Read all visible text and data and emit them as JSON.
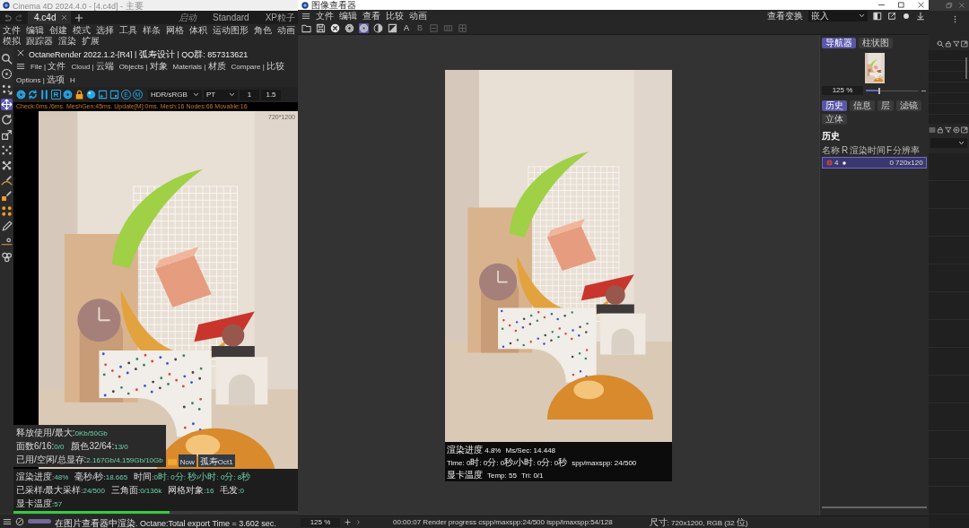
{
  "c4d": {
    "title": "Cinema 4D 2024.4.0 - [4.c4d] - 主要",
    "document_tabs": [
      {
        "label": "4.c4d",
        "selected": true
      }
    ],
    "layouts": [
      "启动",
      "Standard",
      "XP粒子"
    ],
    "menu": [
      "文件",
      "编辑",
      "创建",
      "模式",
      "选择",
      "工具",
      "样条",
      "网格",
      "体积",
      "运动图形",
      "角色",
      "动画",
      "模拟",
      "跟踪器",
      "渲染",
      "扩展"
    ],
    "tools": [
      {
        "selected": false
      },
      {
        "selected": false
      },
      {
        "selected": false
      },
      {
        "selected": true
      },
      {
        "selected": false
      },
      {
        "selected": false
      },
      {
        "selected": false
      },
      {
        "selected": false
      },
      {
        "selected": false
      },
      {
        "selected": false
      },
      {
        "selected": false
      },
      {
        "selected": false
      },
      {
        "selected": false
      },
      {
        "selected": false
      }
    ]
  },
  "octane": {
    "title": "OctaneRender 2022.1.2-[R4]  | 弧寿设计 | QQ群: 857313621",
    "menu": [
      "File | 文件",
      "Cloud | 云端",
      "Objects | 对象",
      "Materials | 材质",
      "Compare | 比较",
      "Options | 选项",
      "H"
    ],
    "toolbar": {
      "letter_buttons": [
        "R",
        "E",
        "M"
      ],
      "dropdowns": [
        "HDR/sRGB",
        "PT"
      ],
      "fields": [
        "1",
        "1.5"
      ]
    },
    "timings": "Check:0ms./6ms. MeshGen:45ms. Update[M]:0ms. Mesh:16 Nodes:66 Movable:16",
    "resolution": "720*1200",
    "memory": [
      [
        {
          "label": "释放使用/最大:",
          "value": "0Kb/50Gb"
        }
      ],
      [
        {
          "label": "面数6/16:",
          "value": "0/0"
        },
        {
          "label": "颜色32/64:",
          "value": "13/0"
        }
      ],
      [
        {
          "label": "已用/空闲/总显存:",
          "value": "2.167Gb/4.159Gb/10Gb"
        }
      ]
    ],
    "hud_tags": [
      "Now",
      "孤寿Oct1"
    ],
    "stats": [
      {
        "label": "渲染进度:",
        "value": "48%"
      },
      {
        "label": "毫秒/秒:",
        "value": "18.665"
      },
      {
        "label": "时间:",
        "value": "0时: 0分: 秒/小时: 0分: 8秒"
      },
      {
        "label": "已采样/最大采样:",
        "value": "24/500"
      },
      {
        "label": "三角面:",
        "value": "0/136k"
      },
      {
        "label": "网格对象:",
        "value": "16"
      },
      {
        "label": "毛发:",
        "value": "0"
      },
      {
        "label": "显卡温度:",
        "value": "57"
      }
    ],
    "progress": {
      "level": 0.55
    }
  },
  "status_bar": {
    "message": "在图片查看器中渲染. Octane:Total export Time = 3.602 sec."
  },
  "viewer": {
    "title": "图像查看器",
    "menu": [
      "文件",
      "编辑",
      "查看",
      "比较",
      "动画"
    ],
    "view_transform": {
      "label": "查看变换",
      "value": "嵌入"
    },
    "toolbar": [
      {
        "kind": "icon",
        "selected": false,
        "disabled": false
      },
      {
        "kind": "icon",
        "selected": false,
        "disabled": false
      },
      {
        "kind": "icon",
        "selected": false,
        "disabled": false
      },
      {
        "kind": "icon",
        "selected": false,
        "disabled": false
      },
      {
        "kind": "icon",
        "selected": true,
        "disabled": false
      },
      {
        "kind": "icon",
        "selected": false,
        "disabled": false
      },
      {
        "kind": "icon",
        "selected": false,
        "disabled": false
      },
      {
        "kind": "text",
        "label": "A",
        "disabled": false
      },
      {
        "kind": "text",
        "label": "B",
        "disabled": true
      },
      {
        "kind": "icon",
        "selected": false,
        "disabled": true
      },
      {
        "kind": "icon",
        "selected": false,
        "disabled": true
      },
      {
        "kind": "icon",
        "selected": false,
        "disabled": true
      }
    ],
    "stamp": [
      "渲染进度 4.8%",
      "Ms/Sec: 14.448",
      "Time: 0时: 0分: 0秒/小时: 0分: 0秒",
      "spp/maxspp: 24/500",
      "显卡温度",
      "Temp: 55",
      "Tri: 0/1"
    ],
    "navigator": {
      "tabs": [
        {
          "label": "导航器",
          "selected": true
        },
        {
          "label": "柱状图",
          "selected": false
        }
      ],
      "zoom": "125 %",
      "zoom_slider": {
        "level": 0.27
      }
    },
    "info_tabs": [
      {
        "label": "历史",
        "selected": true
      },
      {
        "label": "信息",
        "selected": false
      },
      {
        "label": "层",
        "selected": false
      },
      {
        "label": "滤镜",
        "selected": false
      },
      {
        "label": "立体",
        "selected": false
      }
    ],
    "history": {
      "title": "历史",
      "columns": [
        "名称",
        "R",
        "渲染时间",
        "F",
        "分辨率"
      ],
      "rows": [
        {
          "name": "4",
          "r": true,
          "f": "0",
          "resolution": "720x120",
          "selected": true
        }
      ]
    },
    "status": {
      "zoom": "125 %",
      "progress": "00:00:07 Render progress  cspp/maxspp:24/500  ispp/imaxspp:54/128",
      "size": "尺寸: 720x1200, RGB (32 位)"
    }
  }
}
